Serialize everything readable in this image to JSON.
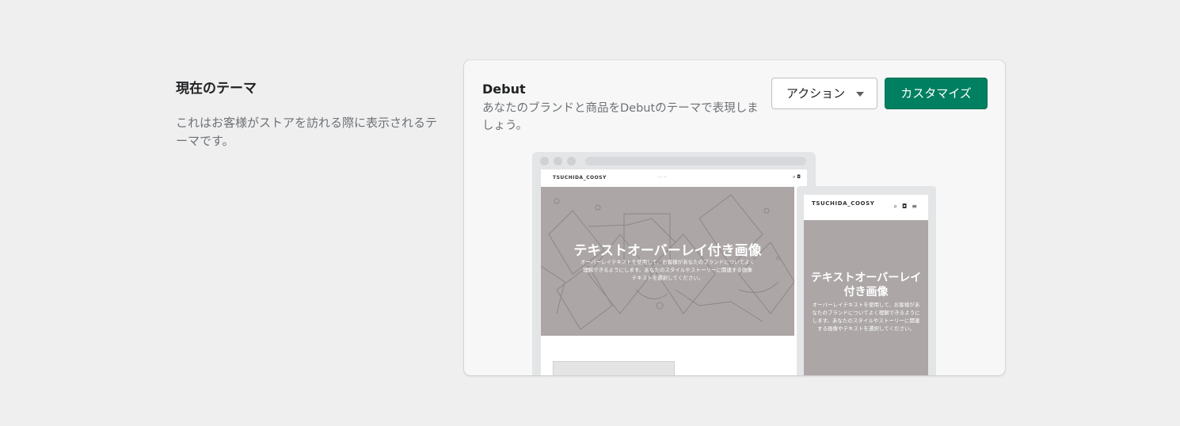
{
  "section": {
    "title": "現在のテーマ",
    "description": "これはお客様がストアを訪れる際に表示されるテーマです。"
  },
  "theme": {
    "name": "Debut",
    "description": "あなたのブランドと商品をDebutのテーマで表現しましょう。",
    "action_label": "アクション",
    "customize_label": "カスタマイズ"
  },
  "preview": {
    "store_name_desktop": "TSUCHIDA_COOSY",
    "store_name_mobile": "TSUCHIDA_COOSY",
    "hero_title": "テキストオーバーレイ付き画像",
    "hero_text_desktop": "オーバーレイテキストを使用して、お客様があなたのブランドについてよく理解できるようにします。あなたのスタイルやストーリーに関連する画像テキストを選択してください。",
    "hero_text_mobile": "オーバーレイテキストを使用して、お客様があなたのブランドについてよく理解できるようにします。あなたのスタイルやストーリーに関連する画像やテキストを選択してください。"
  },
  "colors": {
    "primary": "#008060",
    "hero_bg": "#aca6a6",
    "page_bg": "#efeff0"
  },
  "icons": [
    "caret-down-icon",
    "search-icon",
    "cart-icon",
    "hamburger-icon"
  ]
}
